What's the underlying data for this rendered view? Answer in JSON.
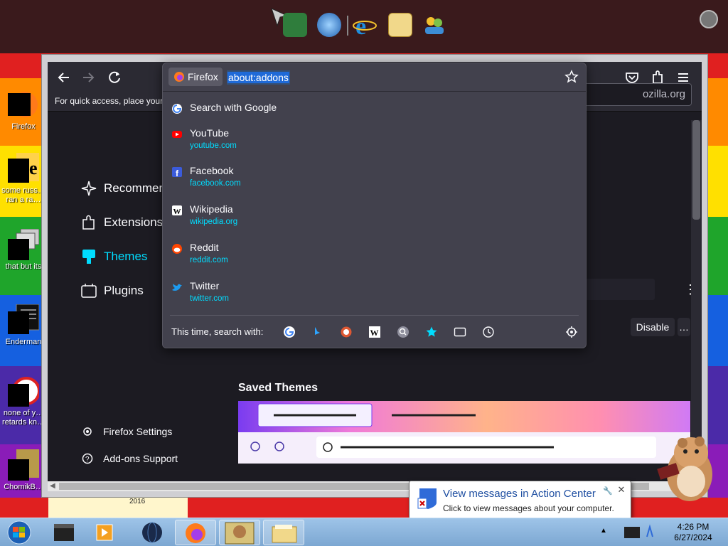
{
  "desktop": {
    "icons": [
      {
        "label": "Firefox"
      },
      {
        "label": "some russ… ran a ra…"
      },
      {
        "label": "that but its"
      },
      {
        "label": "Enderman"
      },
      {
        "label": "none of y… retards kn…"
      },
      {
        "label": "ChomikB…"
      }
    ],
    "stray_label": "2016"
  },
  "browser": {
    "bookmarks_hint": "For quick access, place your b",
    "identity_label": "Firefox",
    "url": "about:addons",
    "search_placeholder": "ozilla.org",
    "categories": [
      {
        "label": "Recommen"
      },
      {
        "label": "Extensions"
      },
      {
        "label": "Themes"
      },
      {
        "label": "Plugins"
      }
    ],
    "footer": [
      {
        "label": "Firefox Settings"
      },
      {
        "label": "Add-ons Support"
      }
    ],
    "disable_label": "Disable",
    "more_label": "…",
    "saved_themes_title": "Saved Themes"
  },
  "urlbar_dropdown": {
    "search_google": "Search with Google",
    "suggestions": [
      {
        "title": "YouTube",
        "url": "youtube.com",
        "icon": "youtube-icon"
      },
      {
        "title": "Facebook",
        "url": "facebook.com",
        "icon": "facebook-icon"
      },
      {
        "title": "Wikipedia",
        "url": "wikipedia.org",
        "icon": "wikipedia-icon"
      },
      {
        "title": "Reddit",
        "url": "reddit.com",
        "icon": "reddit-icon"
      },
      {
        "title": "Twitter",
        "url": "twitter.com",
        "icon": "twitter-icon"
      }
    ],
    "this_time_label": "This time, search with:",
    "engines": [
      "google-icon",
      "bing-icon",
      "duckduckgo-icon",
      "wikipedia-icon",
      "search-icon",
      "bookmarks-icon",
      "tabs-icon",
      "history-icon"
    ]
  },
  "notification": {
    "title": "View messages in Action Center",
    "subtitle": "Click to view messages about your computer.",
    "close": "✕"
  },
  "taskbar": {
    "time": "4:26 PM",
    "date": "6/27/2024",
    "tray_arrow": "▲"
  },
  "colors": {
    "accent": "#00ddff",
    "panel": "#42414d",
    "toolbar": "#2b2a33",
    "content": "#1c1b22"
  }
}
